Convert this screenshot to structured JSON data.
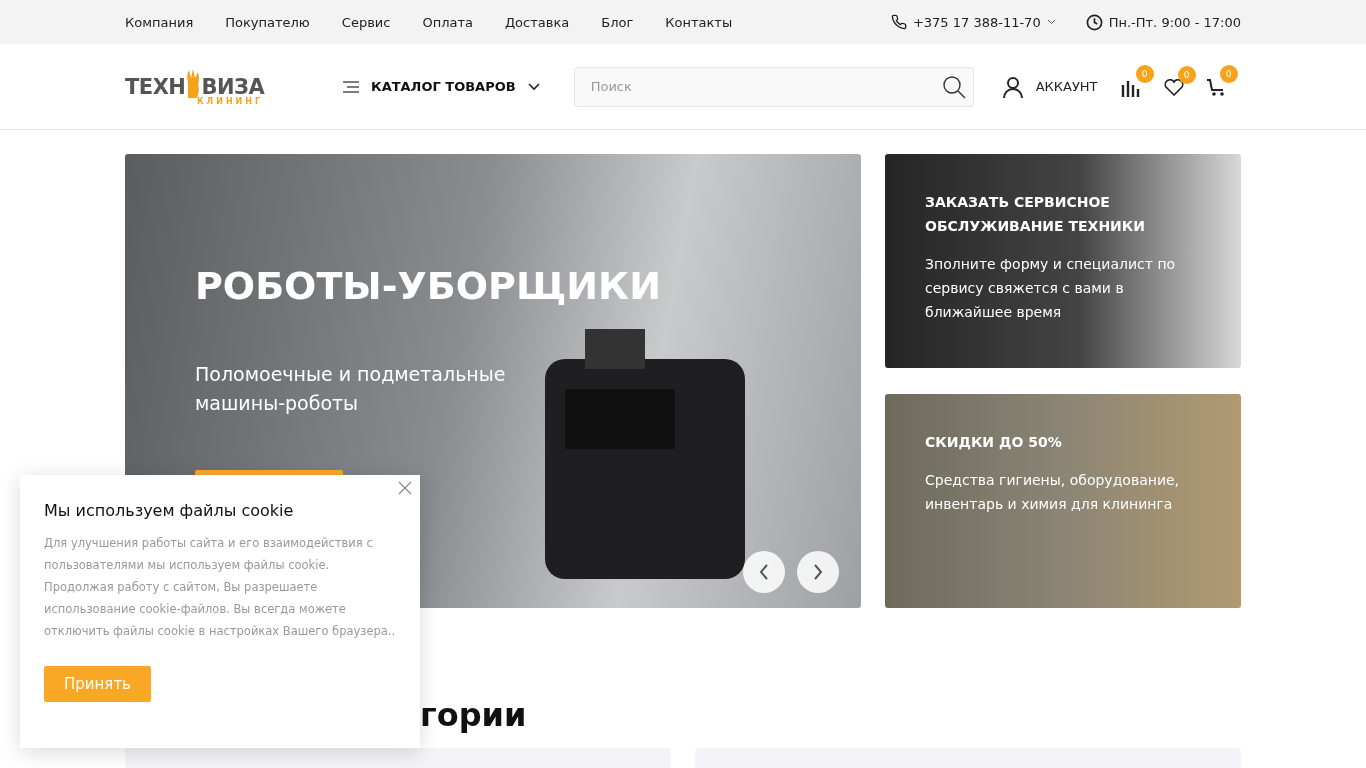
{
  "top_nav": [
    "Компания",
    "Покупателю",
    "Сервис",
    "Оплата",
    "Доставка",
    "Блог",
    "Контакты"
  ],
  "phone": "+375 17 388-11-70",
  "hours": "Пн.-Пт. 9:00 - 17:00",
  "logo": {
    "main_left": "ТЕХН",
    "main_right": "ВИЗА",
    "sub": "КЛИНИНГ"
  },
  "catalog_button": "КАТАЛОГ ТОВАРОВ",
  "search": {
    "placeholder": "Поиск"
  },
  "account": "АККАУНТ",
  "header_icons": [
    {
      "kind": "compare",
      "count": "0"
    },
    {
      "kind": "favorites",
      "count": "0"
    },
    {
      "kind": "cart",
      "count": "0"
    }
  ],
  "hero": {
    "title": "РОБОТЫ-УБОРЩИКИ",
    "subtitle": "Поломоечные и подметальные машины-роботы"
  },
  "promo_cards": [
    {
      "title": "ЗАКАЗАТЬ СЕРВИСНОЕ ОБСЛУЖИВАНИЕ ТЕХНИКИ",
      "text": "Зполните форму и специалист по сервису свяжется с вами в ближайшее время"
    },
    {
      "title": "СКИДКИ ДО 50%",
      "text": "Средства гигиены, оборудование, инвентарь и химия для клининга"
    }
  ],
  "section_title": "гории",
  "cookie": {
    "title": "Мы используем файлы cookie",
    "text": "Для улучшения работы сайта и его взаимодействия с пользователями мы используем файлы cookie. Продолжая работу с сайтом, Вы разрешаете использование cookie-файлов. Вы всегда можете отключить файлы cookie в настройках Вашего браузера..",
    "button": "Принять"
  }
}
